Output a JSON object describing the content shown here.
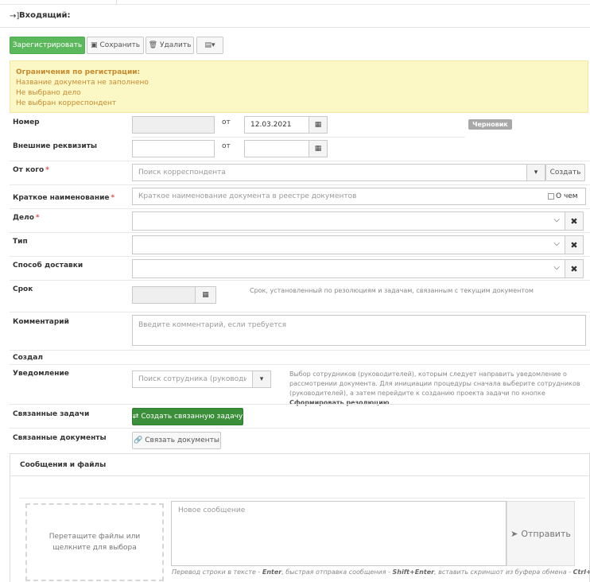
{
  "header": {
    "title": "Входящий:",
    "icon": "sign-in-icon"
  },
  "toolbar": {
    "register_label": "Зарегистрировать",
    "save_label": "Сохранить",
    "delete_label": "Удалить",
    "view_icon": "table-icon"
  },
  "warning": {
    "title": "Ограничения по регистрации:",
    "items": [
      "Название документа не заполнено",
      "Не выбрано дело",
      "Не выбран корреспондент"
    ]
  },
  "form": {
    "number": {
      "label": "Номер",
      "value": "",
      "from_label": "от",
      "date": "12.03.2021",
      "status": "Черновик"
    },
    "external": {
      "label": "Внешние реквизиты",
      "value": "",
      "from_label": "от",
      "date": ""
    },
    "from_whom": {
      "label": "От кого",
      "required": "*",
      "placeholder": "Поиск корреспондента",
      "create_label": "Создать"
    },
    "short_name": {
      "label": "Краткое наименование",
      "required": "*",
      "placeholder": "Краткое наименование документа в реестре документов",
      "checkbox_label": "О чем"
    },
    "case": {
      "label": "Дело",
      "required": "*",
      "value": ""
    },
    "type": {
      "label": "Тип",
      "value": ""
    },
    "delivery": {
      "label": "Способ доставки",
      "value": ""
    },
    "deadline": {
      "label": "Срок",
      "value": "",
      "hint": "Срок, установленный по резолюциям и задачам, связанным с текущим документом"
    },
    "comment": {
      "label": "Комментарий",
      "placeholder": "Введите комментарий, если требуется"
    },
    "created": {
      "label": "Создал"
    },
    "notification": {
      "label": "Уведомление",
      "placeholder": "Поиск сотрудника (руководите",
      "hint_text": "Выбор сотрудников (руководителей), которым следует направить уведомление о рассмотрении документа. Для инициации процедуры сначала выберите сотрудников (руководителей), а затем перейдите к созданию проекта задачи по кнопке",
      "hint_bold": "Сформировать резолюцию"
    },
    "related_tasks": {
      "label": "Связанные задачи",
      "button": "Создать связанную задачу"
    },
    "related_docs": {
      "label": "Связанные документы",
      "button": "Связать документы"
    }
  },
  "messages": {
    "title": "Сообщения и файлы",
    "dropzone": "Перетащите файлы или щелкните для выбора",
    "placeholder": "Новое сообщение",
    "send_label": "Отправить",
    "footnote_1": "Перевод строки в тексте - ",
    "footnote_k1": "Enter",
    "footnote_2": ", быстрая отправка сообщения - ",
    "footnote_k2": "Shift+Enter",
    "footnote_3": ", вставить скриншот из буфера обмена - ",
    "footnote_k3": "Ctrl+V"
  }
}
